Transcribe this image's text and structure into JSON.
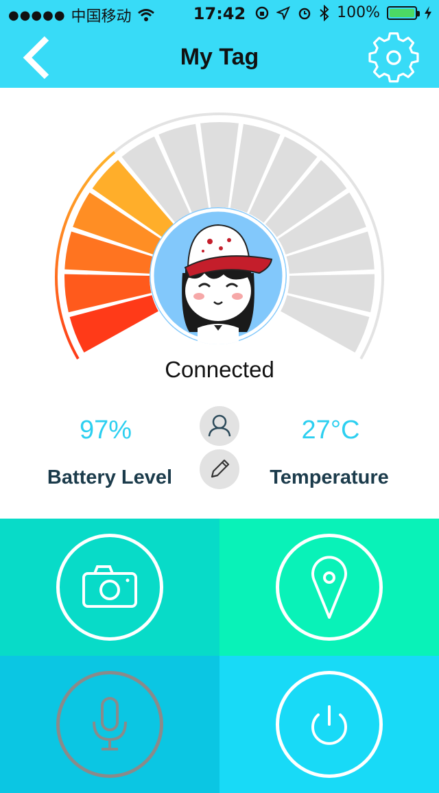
{
  "status_bar": {
    "carrier": "中国移动",
    "time": "17:42",
    "battery_percent": "100%",
    "battery_level": 1.0
  },
  "nav": {
    "title": "My Tag",
    "back_icon": "chevron-left-icon",
    "settings_icon": "gear-icon"
  },
  "device": {
    "status": "Connected",
    "signal_level_segments": 5,
    "total_segments": 15
  },
  "stats": {
    "battery_value": "97%",
    "battery_label": "Battery Level",
    "temperature_value": "27°C",
    "temperature_label": "Temperature"
  },
  "actions": {
    "camera_icon": "camera-icon",
    "location_icon": "location-pin-icon",
    "microphone_icon": "microphone-icon",
    "power_icon": "power-icon"
  },
  "colors": {
    "nav_bg": "#38dbf7",
    "accent": "#2ccff0",
    "tile_camera": "#08dbc8",
    "tile_location": "#09f2b8",
    "tile_mic": "#0bc6e3",
    "tile_power": "#18daf7"
  }
}
